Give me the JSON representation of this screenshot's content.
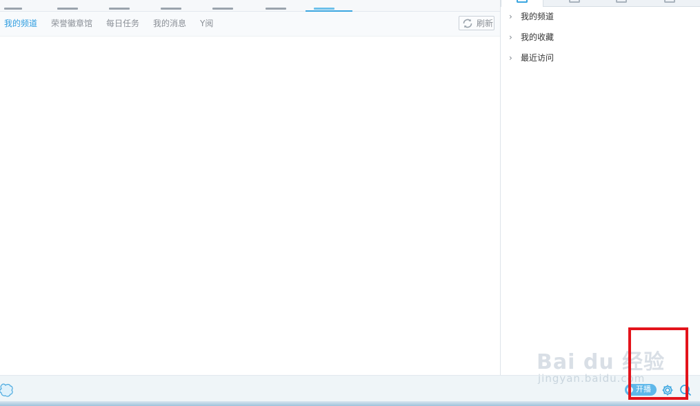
{
  "subnav": {
    "items": [
      "我的频道",
      "荣誉徽章馆",
      "每日任务",
      "我的消息",
      "Y阅"
    ],
    "refresh_label": "刷新"
  },
  "sidebar": {
    "tree": [
      "我的频道",
      "我的收藏",
      "最近访问"
    ]
  },
  "bottom": {
    "live_button_label": "开播"
  },
  "watermark": {
    "logo_text": "Bai du 经验",
    "url_text": "jingyan.baidu.com"
  },
  "icons": {
    "refresh": "refresh-icon",
    "chevron": "chevron-right-icon",
    "gear": "gear-icon",
    "search": "search-icon",
    "mascot": "mascot-icon"
  },
  "colors": {
    "accent": "#3aa6e0",
    "highlight": "#e3131b",
    "live_button": "#5fb8ea"
  }
}
